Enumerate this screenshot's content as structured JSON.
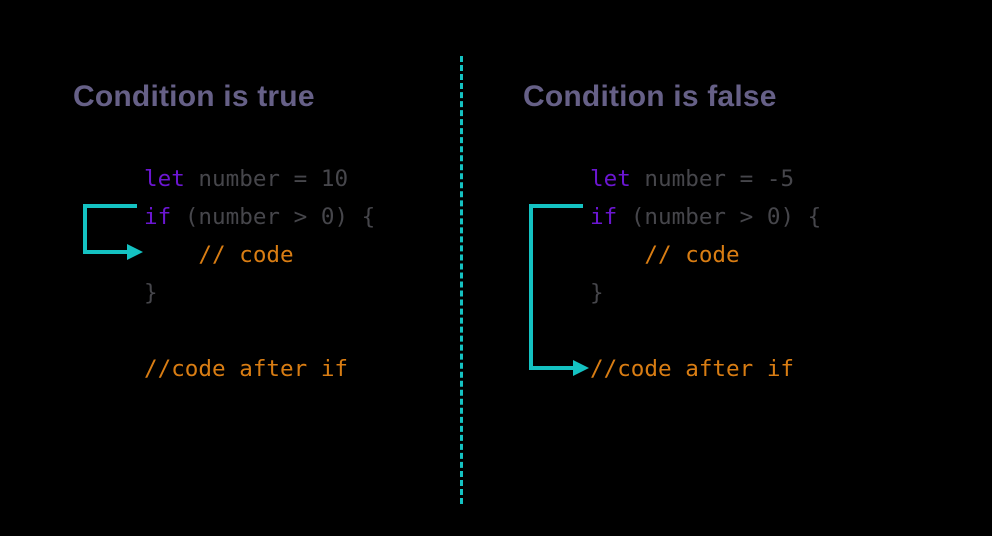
{
  "colors": {
    "bg": "#000000",
    "heading": "#666087",
    "code": "#46464b",
    "keyword": "#6b16d1",
    "comment": "#d97d13",
    "accent": "#14c2c2"
  },
  "left": {
    "heading": "Condition is true",
    "code": {
      "kw1": "let",
      "kw2": "if",
      "line1_rest": " number = 10",
      "line2_rest": " (number > 0) {",
      "comment_inside": "// code",
      "closing": "}",
      "comment_after": "//code after if"
    },
    "arrow_target": "inside_if"
  },
  "right": {
    "heading": "Condition is false",
    "code": {
      "kw1": "let",
      "kw2": "if",
      "line1_rest": " number = -5",
      "line2_rest": " (number > 0) {",
      "comment_inside": "// code",
      "closing": "}",
      "comment_after": "//code after if"
    },
    "arrow_target": "after_if"
  }
}
